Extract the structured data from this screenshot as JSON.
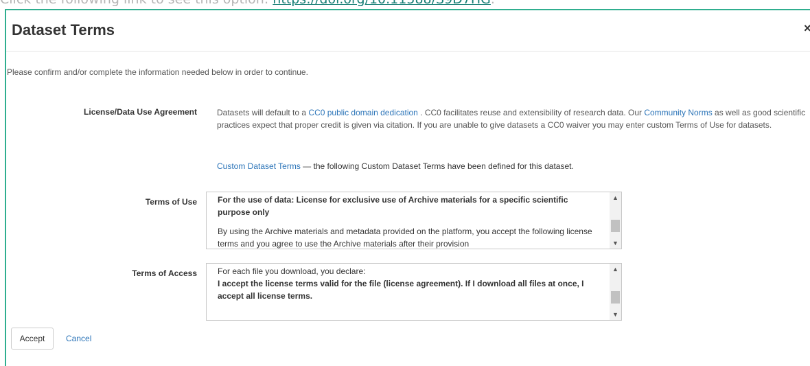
{
  "background": {
    "prefix": "Click the following link to see this option: ",
    "link": "https://doi.org/10.11588/S9D7HG",
    "suffix": "."
  },
  "dialog": {
    "title": "Dataset Terms",
    "close_symbol": "×",
    "intro": "Please confirm and/or complete the information needed below in order to continue.",
    "license_label": "License/Data Use Agreement",
    "license_text": {
      "part1": "Datasets will default to a ",
      "cc0_link": "CC0 public domain dedication",
      "part2": " . CC0 facilitates reuse and extensibility of research data. Our ",
      "norms_link": "Community Norms",
      "part3": " as well as good scientific practices expect that proper credit is given via citation. If you are unable to give datasets a CC0 waiver you may enter custom Terms of Use for datasets."
    },
    "custom_terms": {
      "link": "Custom Dataset Terms",
      "text": " — the following Custom Dataset Terms have been defined for this dataset."
    },
    "terms_of_use": {
      "label": "Terms of Use",
      "heading": "For the use of data: License for exclusive use of Archive materials for a specific scientific purpose only",
      "body": "By using the Archive materials and metadata provided on the platform, you accept the following license terms and you agree to use the Archive materials after their provision"
    },
    "terms_of_access": {
      "label": "Terms of Access",
      "line1": "For each file you download, you declare:",
      "bold": "I accept the license terms valid for the file (license agreement). If I download all files at once, I accept all license terms."
    },
    "accept_label": "Accept",
    "cancel_label": "Cancel"
  },
  "colors": {
    "accent": "#2fae8f",
    "link": "#2b74b8"
  }
}
